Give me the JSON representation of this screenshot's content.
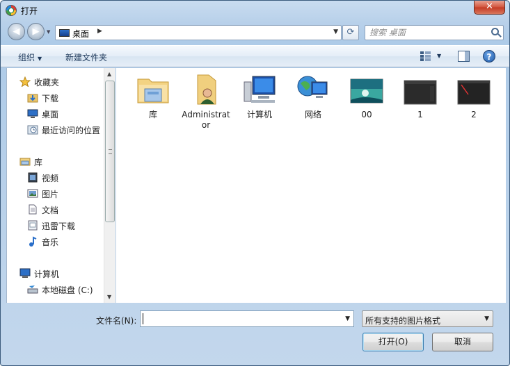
{
  "window": {
    "title": "打开",
    "close_label": "✕"
  },
  "nav": {
    "back_label": "◀",
    "forward_label": "▶",
    "address_crumb": "桌面",
    "search_placeholder": "搜索 桌面"
  },
  "toolbar": {
    "organize_label": "组织",
    "new_folder_label": "新建文件夹",
    "help_label": "?"
  },
  "sidebar": {
    "items": [
      {
        "label": "收藏夹",
        "icon": "star-icon"
      },
      {
        "label": "下载",
        "icon": "download-folder-icon"
      },
      {
        "label": "桌面",
        "icon": "desktop-icon"
      },
      {
        "label": "最近访问的位置",
        "icon": "recent-places-icon"
      },
      {
        "label": "库",
        "icon": "library-icon"
      },
      {
        "label": "视频",
        "icon": "video-icon"
      },
      {
        "label": "图片",
        "icon": "pictures-icon"
      },
      {
        "label": "文档",
        "icon": "documents-icon"
      },
      {
        "label": "迅雷下载",
        "icon": "thunder-download-icon"
      },
      {
        "label": "音乐",
        "icon": "music-icon"
      },
      {
        "label": "计算机",
        "icon": "computer-icon"
      },
      {
        "label": "本地磁盘 (C:)",
        "icon": "local-disk-icon"
      }
    ]
  },
  "files": [
    {
      "name": "库",
      "icon": "library-folder-icon"
    },
    {
      "name": "Administrator",
      "icon": "user-folder-icon"
    },
    {
      "name": "计算机",
      "icon": "computer-icon"
    },
    {
      "name": "网络",
      "icon": "network-icon"
    },
    {
      "name": "00",
      "icon": "image-thumbnail"
    },
    {
      "name": "1",
      "icon": "image-thumbnail"
    },
    {
      "name": "2",
      "icon": "image-thumbnail"
    }
  ],
  "footer": {
    "filename_label": "文件名(N):",
    "filename_value": "",
    "filter_selected": "所有支持的图片格式",
    "open_label": "打开(O)",
    "cancel_label": "取消"
  }
}
